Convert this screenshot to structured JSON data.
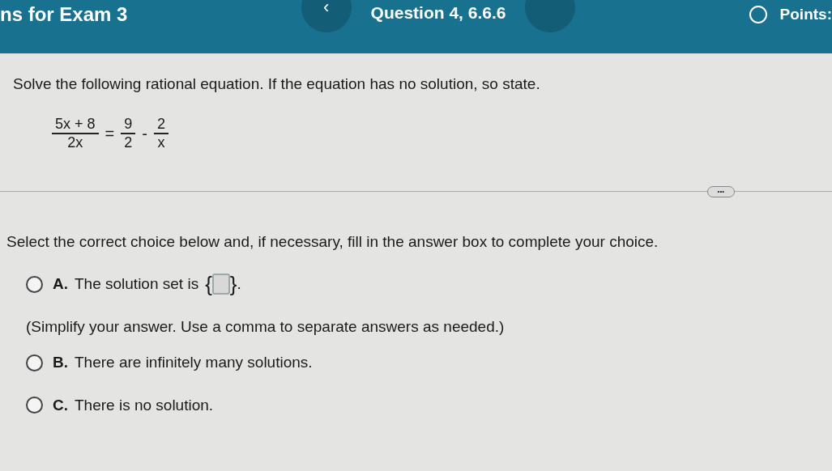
{
  "header": {
    "title": "ns for Exam 3",
    "question": "Question 4, 6.6.6",
    "prev_symbol": "‹",
    "points_label": "Points:"
  },
  "prompt": "Solve the following rational equation. If the equation has no solution, so state.",
  "equation": [
    {
      "kind": "fraction",
      "numerator": "5x + 8",
      "denominator": "2x"
    },
    {
      "kind": "symbol",
      "text": "="
    },
    {
      "kind": "fraction",
      "numerator": "9",
      "denominator": "2"
    },
    {
      "kind": "symbol",
      "text": "-"
    },
    {
      "kind": "fraction",
      "numerator": "2",
      "denominator": "x"
    }
  ],
  "more_symbol": "•••",
  "instruction": "Select the correct choice below and, if necessary, fill in the answer box to complete your choice.",
  "choices": [
    {
      "kind": "answer_box",
      "letter": "A.",
      "text": "The solution set is",
      "open": "{",
      "close": "}",
      "end": ".",
      "note": "(Simplify your answer. Use a comma to separate answers as needed.)",
      "selected": false
    },
    {
      "kind": "plain",
      "letter": "B.",
      "text": "There are infinitely many solutions.",
      "selected": false
    },
    {
      "kind": "plain",
      "letter": "C.",
      "text": "There is no solution.",
      "selected": false
    }
  ]
}
